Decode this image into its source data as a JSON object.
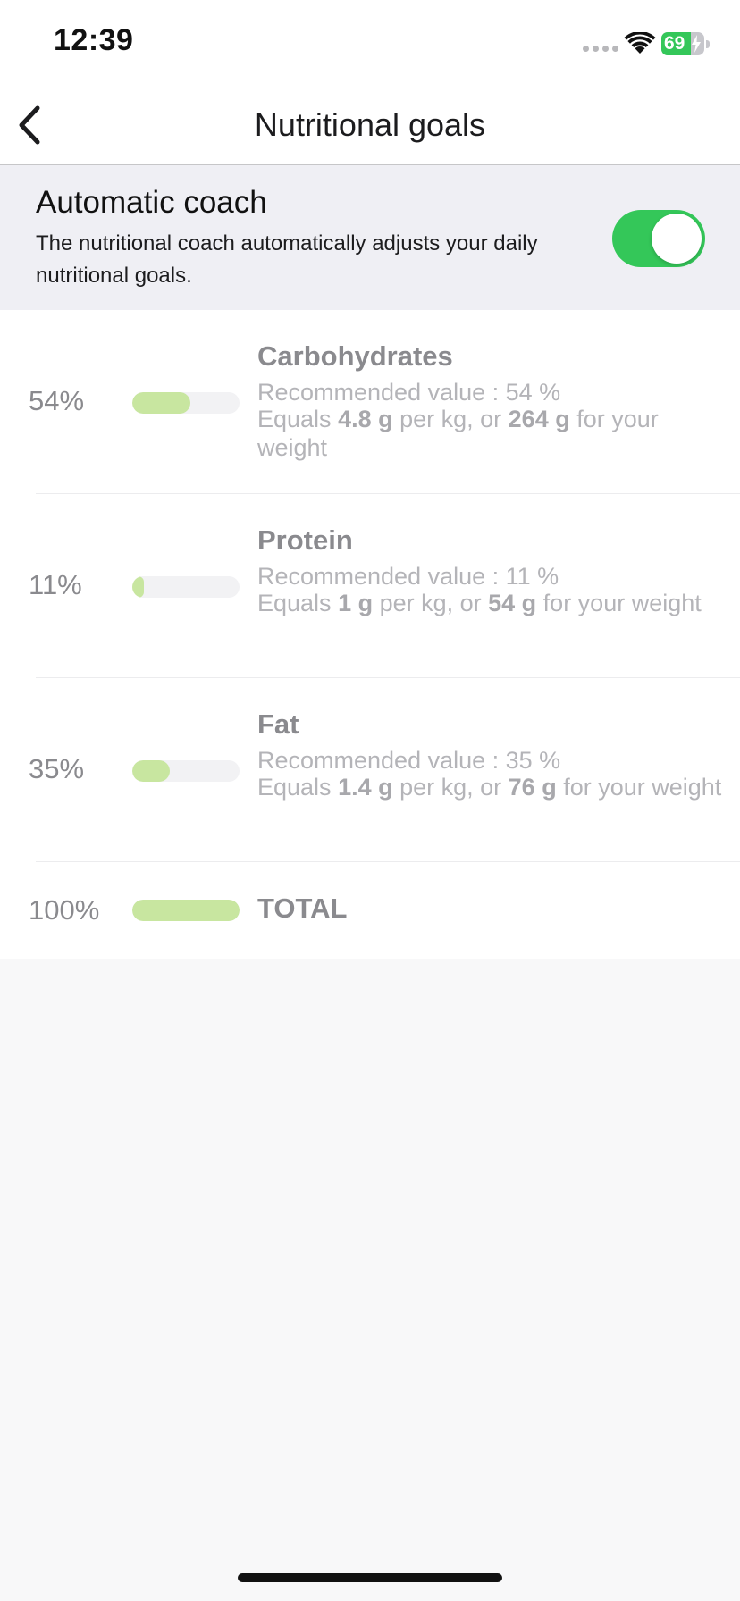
{
  "status_bar": {
    "time": "12:39",
    "battery_level": "69",
    "battery_fraction": 0.69,
    "battery_color": "#34c759",
    "icons": [
      "cellular-signal-icon",
      "wifi-icon",
      "battery-charging-icon"
    ]
  },
  "nav": {
    "title": "Nutritional goals",
    "back_icon": "chevron-left-icon"
  },
  "coach": {
    "title": "Automatic coach",
    "description": "The nutritional coach automatically adjusts your daily nutritional goals.",
    "toggle_on": true,
    "toggle_color": "#34c759"
  },
  "macros": [
    {
      "name": "Carbohydrates",
      "percent_label": "54%",
      "percent_value": 54,
      "recommended": "Recommended value : 54 %",
      "equals_prefix": "Equals ",
      "per_kg": "4.8 g",
      "equals_mid": " per kg, or ",
      "total_grams": "264 g",
      "equals_suffix": " for your weight"
    },
    {
      "name": "Protein",
      "percent_label": "11%",
      "percent_value": 11,
      "recommended": "Recommended value : 11 %",
      "equals_prefix": "Equals ",
      "per_kg": "1 g",
      "equals_mid": " per kg, or ",
      "total_grams": "54 g",
      "equals_suffix": " for your weight"
    },
    {
      "name": "Fat",
      "percent_label": "35%",
      "percent_value": 35,
      "recommended": "Recommended value : 35 %",
      "equals_prefix": "Equals ",
      "per_kg": "1.4 g",
      "equals_mid": " per kg, or ",
      "total_grams": "76 g",
      "equals_suffix": " for your weight"
    }
  ],
  "total": {
    "name": "TOTAL",
    "percent_label": "100%",
    "percent_value": 100
  },
  "colors": {
    "bar_fill": "#c8e6a0",
    "bar_track": "#f2f2f4"
  }
}
